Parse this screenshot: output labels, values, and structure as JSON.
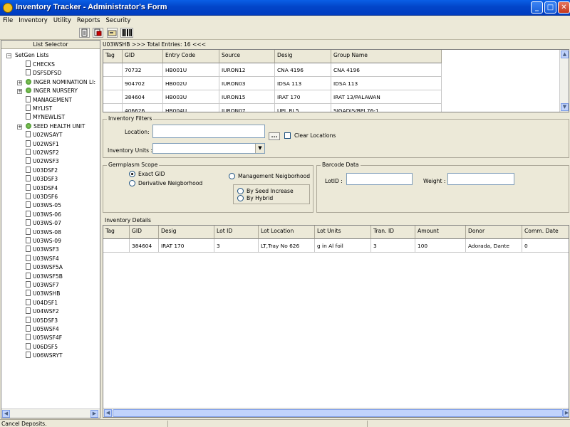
{
  "window": {
    "title": "Inventory Tracker - Administrator's Form",
    "min": "_",
    "max": "□",
    "close": "✕"
  },
  "menu": [
    "File",
    "Inventory",
    "Utility",
    "Reports",
    "Security"
  ],
  "toolbar": {
    "icons": [
      "new-doc-icon",
      "print-icon",
      "card-icon",
      "barcode-icon"
    ]
  },
  "list_selector": {
    "title": "List Selector",
    "root": "SetGen Lists",
    "items": [
      {
        "label": "CHECKS",
        "type": "list"
      },
      {
        "label": "DSFSDFSD",
        "type": "list"
      },
      {
        "label": "INGER NOMINATION LI:",
        "type": "group"
      },
      {
        "label": "INGER NURSERY",
        "type": "group"
      },
      {
        "label": "MANAGEMENT",
        "type": "list"
      },
      {
        "label": "MYLIST",
        "type": "list"
      },
      {
        "label": "MYNEWLIST",
        "type": "list"
      },
      {
        "label": "SEED HEALTH UNIT",
        "type": "group"
      },
      {
        "label": "U02WSAYT",
        "type": "list"
      },
      {
        "label": "U02WSF1",
        "type": "list"
      },
      {
        "label": "U02WSF2",
        "type": "list"
      },
      {
        "label": "U02WSF3",
        "type": "list"
      },
      {
        "label": "U03DSF2",
        "type": "list"
      },
      {
        "label": "U03DSF3",
        "type": "list"
      },
      {
        "label": "U03DSF4",
        "type": "list"
      },
      {
        "label": "U03DSF6",
        "type": "list"
      },
      {
        "label": "U03WS-05",
        "type": "list"
      },
      {
        "label": "U03WS-06",
        "type": "list"
      },
      {
        "label": "U03WS-07",
        "type": "list"
      },
      {
        "label": "U03WS-08",
        "type": "list"
      },
      {
        "label": "U03WS-09",
        "type": "list"
      },
      {
        "label": "U03WSF3",
        "type": "list"
      },
      {
        "label": "U03WSF4",
        "type": "list"
      },
      {
        "label": "U03WSF5A",
        "type": "list"
      },
      {
        "label": "U03WSF5B",
        "type": "list"
      },
      {
        "label": "U03WSF7",
        "type": "list"
      },
      {
        "label": "U03WSHB",
        "type": "list"
      },
      {
        "label": "U04DSF1",
        "type": "list"
      },
      {
        "label": "U04WSF2",
        "type": "list"
      },
      {
        "label": "U05DSF3",
        "type": "list"
      },
      {
        "label": "U05WSF4",
        "type": "list"
      },
      {
        "label": "U05WSF4F",
        "type": "list"
      },
      {
        "label": "U06DSF5",
        "type": "list"
      },
      {
        "label": "U06WSRYT",
        "type": "list"
      }
    ]
  },
  "entries": {
    "header": "U03WSHB >>> Total Entries: 16 <<<",
    "columns": [
      "Tag",
      "GID",
      "Entry Code",
      "Source",
      "Desig",
      "Group Name"
    ],
    "rows": [
      [
        "",
        "70732",
        "HB001U",
        "IURON12",
        "CNA 4196",
        "CNA 4196"
      ],
      [
        "",
        "904702",
        "HB002U",
        "IURON03",
        "IDSA 113",
        "IDSA 113"
      ],
      [
        "",
        "384604",
        "HB003U",
        "IURON15",
        "IRAT 170",
        "IRAT 13/PALAWAN"
      ],
      [
        "",
        "406626",
        "HB004U",
        "IURON07",
        "UPL RI 5",
        "SIGADIS/BPI 76-1"
      ]
    ]
  },
  "filters": {
    "title": "Inventory Filters",
    "location_label": "Location:",
    "location_value": "",
    "browse": "...",
    "clear_locations": "Clear Locations",
    "units_label": "Inventory Units :",
    "units_value": ""
  },
  "scope": {
    "title": "Germplasm Scope",
    "exact": "Exact GID",
    "derivative": "Derivative Neigborhood",
    "management": "Management Neigborhood",
    "by_seed": "By Seed Increase",
    "by_hybrid": "By Hybrid"
  },
  "barcode": {
    "title": "Barcode Data",
    "lotid_label": "LotID :",
    "lotid_value": "",
    "weight_label": "Weight :",
    "weight_value": ""
  },
  "details": {
    "title": "Inventory Details",
    "columns": [
      "Tag",
      "GID",
      "Desig",
      "Lot ID",
      "Lot Location",
      "Lot Units",
      "Tran. ID",
      "Amount",
      "Donor",
      "Comm. Date"
    ],
    "rows": [
      [
        "",
        "384604",
        "IRAT 170",
        "3",
        "LT,Tray No 626",
        "g in Al foil",
        "3",
        "100",
        "Adorada, Dante",
        "0"
      ]
    ]
  },
  "status": {
    "text": "Cancel Deposits."
  },
  "colors": {
    "title_bar": "#0245c9",
    "window_bg": "#ece9d8",
    "grid_bg": "#ffffff"
  }
}
